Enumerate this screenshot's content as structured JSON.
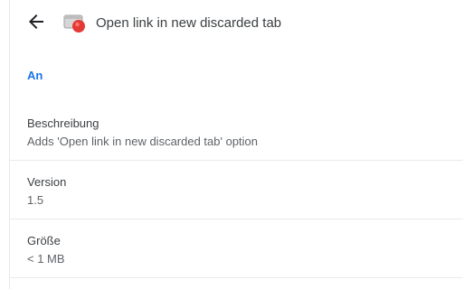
{
  "header": {
    "title": "Open link in new discarded tab",
    "back_icon": "arrow-left-icon",
    "extension_icon": "discarded-tab-icon"
  },
  "toggle": {
    "state_label": "An",
    "accent_color": "#1a73e8"
  },
  "details": [
    {
      "label": "Beschreibung",
      "value": "Adds 'Open link in new discarded tab' option"
    },
    {
      "label": "Version",
      "value": "1.5"
    },
    {
      "label": "Größe",
      "value": "< 1 MB"
    }
  ]
}
